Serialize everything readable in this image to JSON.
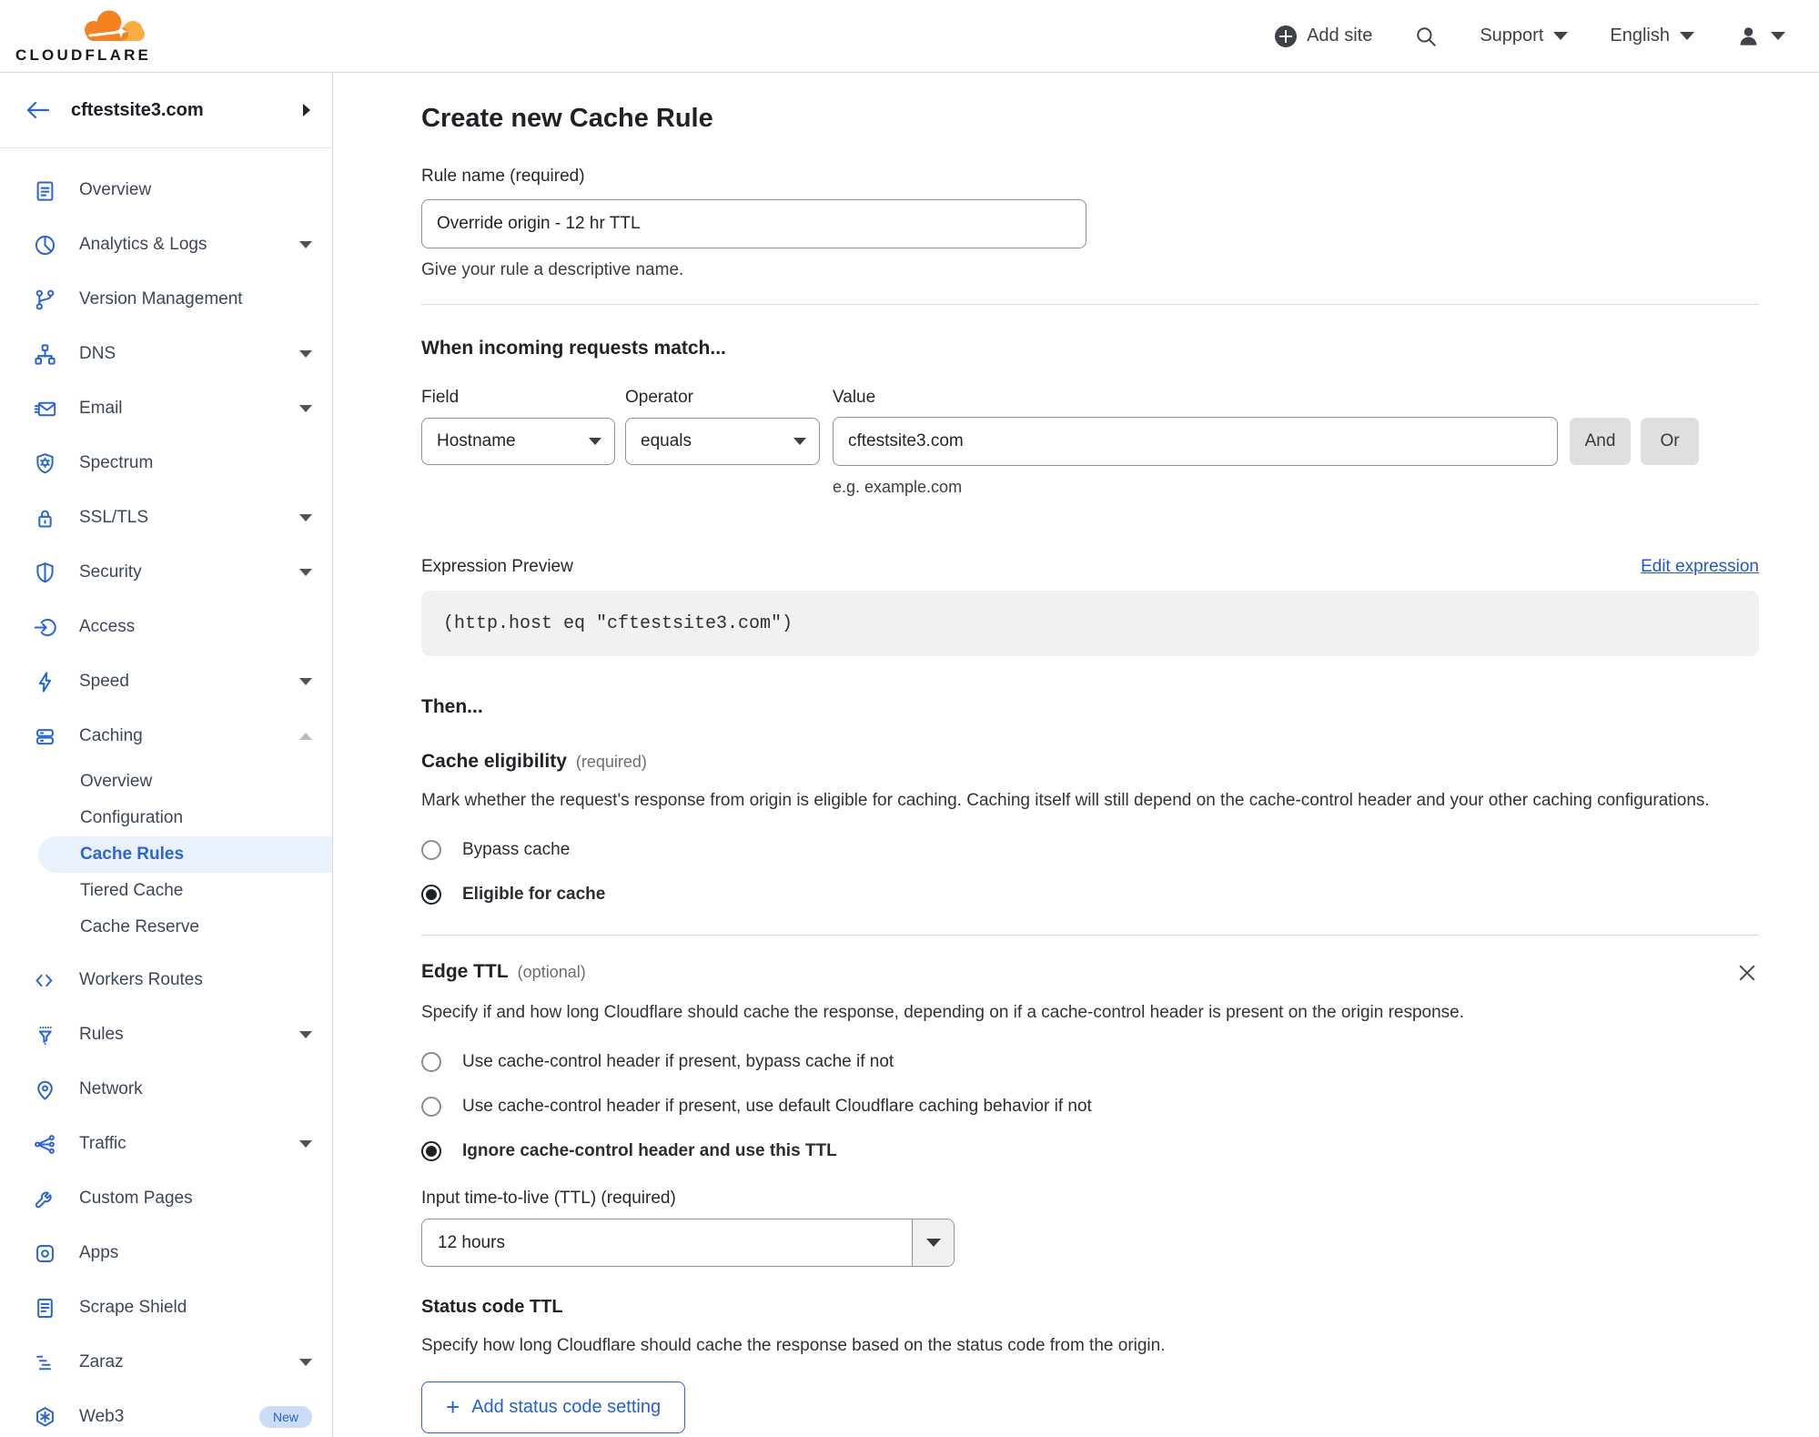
{
  "header": {
    "brand": "CLOUDFLARE",
    "add_site_label": "Add site",
    "support_label": "Support",
    "language_label": "English"
  },
  "sidebar": {
    "site": "cftestsite3.com",
    "items": [
      {
        "label": "Overview",
        "icon": "clipboard"
      },
      {
        "label": "Analytics & Logs",
        "icon": "pie-chart",
        "expandable": true
      },
      {
        "label": "Version Management",
        "icon": "git-branch"
      },
      {
        "label": "DNS",
        "icon": "hierarchy",
        "expandable": true
      },
      {
        "label": "Email",
        "icon": "envelope",
        "expandable": true
      },
      {
        "label": "Spectrum",
        "icon": "shield-gear"
      },
      {
        "label": "SSL/TLS",
        "icon": "padlock",
        "expandable": true
      },
      {
        "label": "Security",
        "icon": "shield",
        "expandable": true
      },
      {
        "label": "Access",
        "icon": "login-arrow"
      },
      {
        "label": "Speed",
        "icon": "lightning-bolt",
        "expandable": true
      },
      {
        "label": "Caching",
        "icon": "server-stack",
        "expandable": true,
        "expanded": true,
        "children": [
          {
            "label": "Overview"
          },
          {
            "label": "Configuration"
          },
          {
            "label": "Cache Rules",
            "active": true
          },
          {
            "label": "Tiered Cache"
          },
          {
            "label": "Cache Reserve"
          }
        ]
      },
      {
        "label": "Workers Routes",
        "icon": "code-brackets"
      },
      {
        "label": "Rules",
        "icon": "funnel",
        "expandable": true
      },
      {
        "label": "Network",
        "icon": "map-pin"
      },
      {
        "label": "Traffic",
        "icon": "share-split",
        "expandable": true
      },
      {
        "label": "Custom Pages",
        "icon": "wrench"
      },
      {
        "label": "Apps",
        "icon": "app-square"
      },
      {
        "label": "Scrape Shield",
        "icon": "document"
      },
      {
        "label": "Zaraz",
        "icon": "stair-bars",
        "expandable": true
      },
      {
        "label": "Web3",
        "icon": "hexagon",
        "badge": "New"
      }
    ]
  },
  "main": {
    "title": "Create new Cache Rule",
    "rule_name": {
      "label": "Rule name (required)",
      "value": "Override origin - 12 hr TTL",
      "helper": "Give your rule a descriptive name."
    },
    "match": {
      "heading": "When incoming requests match...",
      "field_label": "Field",
      "field_value": "Hostname",
      "operator_label": "Operator",
      "operator_value": "equals",
      "value_label": "Value",
      "value": "cftestsite3.com",
      "value_hint": "e.g. example.com",
      "and_label": "And",
      "or_label": "Or"
    },
    "expression": {
      "label": "Expression Preview",
      "edit_link": "Edit expression",
      "code": "(http.host eq \"cftestsite3.com\")"
    },
    "then_heading": "Then...",
    "cache_eligibility": {
      "heading": "Cache eligibility",
      "qualifier": "(required)",
      "description": "Mark whether the request's response from origin is eligible for caching. Caching itself will still depend on the cache-control header and your other caching configurations.",
      "options": [
        {
          "label": "Bypass cache",
          "selected": false
        },
        {
          "label": "Eligible for cache",
          "selected": true
        }
      ]
    },
    "edge_ttl": {
      "heading": "Edge TTL",
      "qualifier": "(optional)",
      "description": "Specify if and how long Cloudflare should cache the response, depending on if a cache-control header is present on the origin response.",
      "options": [
        {
          "label": "Use cache-control header if present, bypass cache if not",
          "selected": false
        },
        {
          "label": "Use cache-control header if present, use default Cloudflare caching behavior if not",
          "selected": false
        },
        {
          "label": "Ignore cache-control header and use this TTL",
          "selected": true
        }
      ],
      "ttl_label": "Input time-to-live (TTL) (required)",
      "ttl_value": "12 hours"
    },
    "status_code_ttl": {
      "heading": "Status code TTL",
      "description": "Specify how long Cloudflare should cache the response based on the status code from the origin.",
      "add_button": "Add status code setting"
    }
  },
  "colors": {
    "accent_blue": "#2b65d9",
    "link_blue": "#2257d0",
    "brand_orange": "#f6821f",
    "brand_orange_light": "#fbad41",
    "active_item_bg": "#e9f1fc",
    "code_bg": "#f1f1f2",
    "button_gray_bg": "#dfdfdf"
  }
}
